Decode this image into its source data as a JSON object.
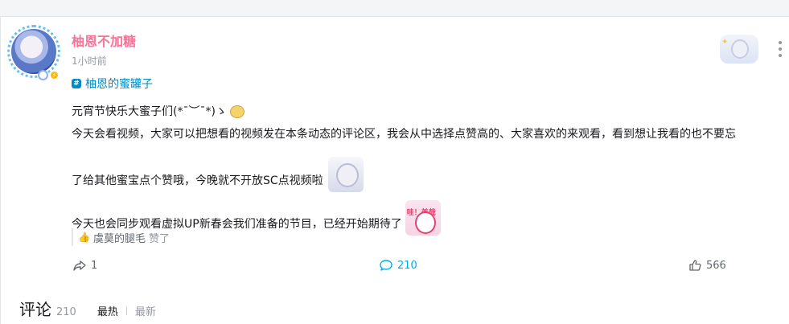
{
  "post": {
    "author": "柚恩不加糖",
    "time": "1小时前",
    "topic": "柚恩的蜜罐子",
    "content": {
      "line1": "元宵节快乐大蜜子们(*¯︶¯*)ゝ",
      "line2": "今天会看视频，大家可以把想看的视频发在本条动态的评论区，我会从中选择点赞高的、大家喜欢的来观看，看到想让我看的也不要忘",
      "line3": "了给其他蜜宝点个赞哦，今晚就不开放SC点视频啦",
      "line4": "今天也会同步观看虚拟UP新春会我们准备的节目，已经开始期待了"
    },
    "sticker2_label": "哇！美哉",
    "liked_by": {
      "user": "虞莫的腿毛",
      "text": "赞了"
    }
  },
  "actions": {
    "share_count": "1",
    "comment_count": "210",
    "like_count": "566"
  },
  "comments": {
    "title": "评论",
    "count": "210",
    "sort_hot": "最热",
    "sort_new": "最新"
  },
  "colors": {
    "username": "#fb7299",
    "link": "#008ac5",
    "accent": "#00aeec",
    "muted": "#9499a0"
  }
}
